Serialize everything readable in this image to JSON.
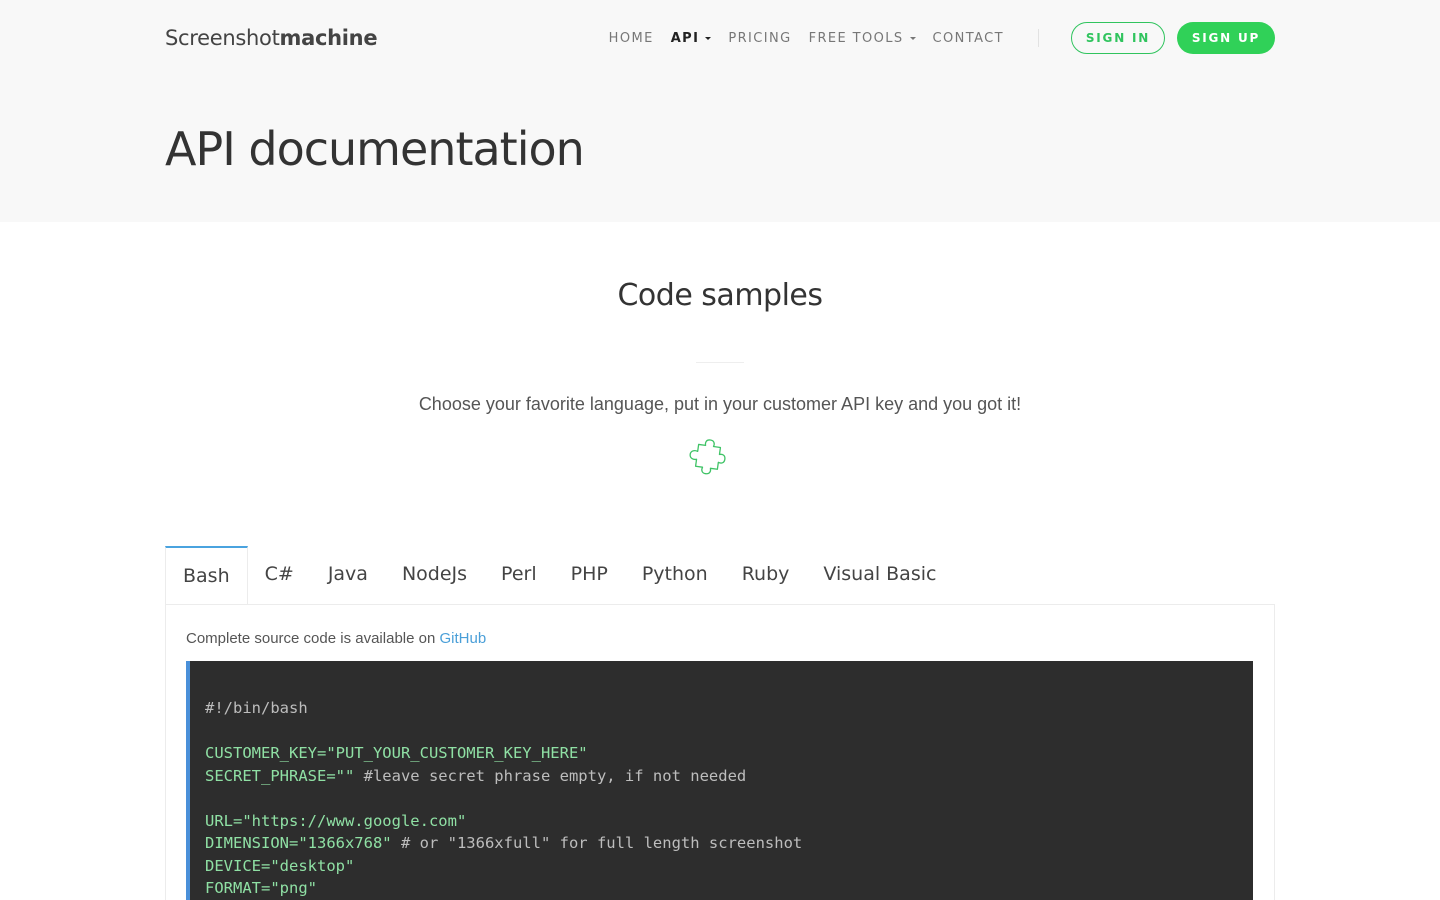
{
  "brand": {
    "light": "Screenshot",
    "bold": "machine"
  },
  "nav": {
    "items": [
      {
        "label": "HOME",
        "active": false,
        "dropdown": false
      },
      {
        "label": "API",
        "active": true,
        "dropdown": true
      },
      {
        "label": "PRICING",
        "active": false,
        "dropdown": false
      },
      {
        "label": "FREE TOOLS",
        "active": false,
        "dropdown": true
      },
      {
        "label": "CONTACT",
        "active": false,
        "dropdown": false
      }
    ],
    "sign_in": "SIGN IN",
    "sign_up": "SIGN UP"
  },
  "header": {
    "title": "API documentation"
  },
  "section": {
    "title": "Code samples",
    "lead": "Choose your favorite language, put in your customer API key and you got it!"
  },
  "tabs": [
    "Bash",
    "C#",
    "Java",
    "NodeJs",
    "Perl",
    "PHP",
    "Python",
    "Ruby",
    "Visual Basic"
  ],
  "active_tab": "Bash",
  "panel": {
    "note_prefix": "Complete source code is available on ",
    "note_link": "GitHub"
  },
  "code_lines": [
    {
      "parts": [
        {
          "t": "#!/bin/bash",
          "c": "cmt"
        }
      ]
    },
    {
      "parts": []
    },
    {
      "parts": [
        {
          "t": "CUSTOMER_KEY=\"PUT_YOUR_CUSTOMER_KEY_HERE\"",
          "c": "str"
        }
      ]
    },
    {
      "parts": [
        {
          "t": "SECRET_PHRASE=\"\"",
          "c": "str"
        },
        {
          "t": " #leave secret phrase empty, if not needed",
          "c": "cmt"
        }
      ]
    },
    {
      "parts": []
    },
    {
      "parts": [
        {
          "t": "URL=\"https://www.google.com\"",
          "c": "str"
        }
      ]
    },
    {
      "parts": [
        {
          "t": "DIMENSION=\"1366x768\"",
          "c": "str"
        },
        {
          "t": " # or \"1366xfull\" for full length screenshot",
          "c": "cmt"
        }
      ]
    },
    {
      "parts": [
        {
          "t": "DEVICE=\"desktop\"",
          "c": "str"
        }
      ]
    },
    {
      "parts": [
        {
          "t": "FORMAT=\"png\"",
          "c": "str"
        }
      ]
    }
  ],
  "colors": {
    "accent_green": "#30d158",
    "tab_active_border": "#4aa3df",
    "link_blue": "#4a9fd8",
    "code_bg": "#2d2d2d"
  },
  "icons": {
    "puzzle": "puzzle-icon"
  }
}
